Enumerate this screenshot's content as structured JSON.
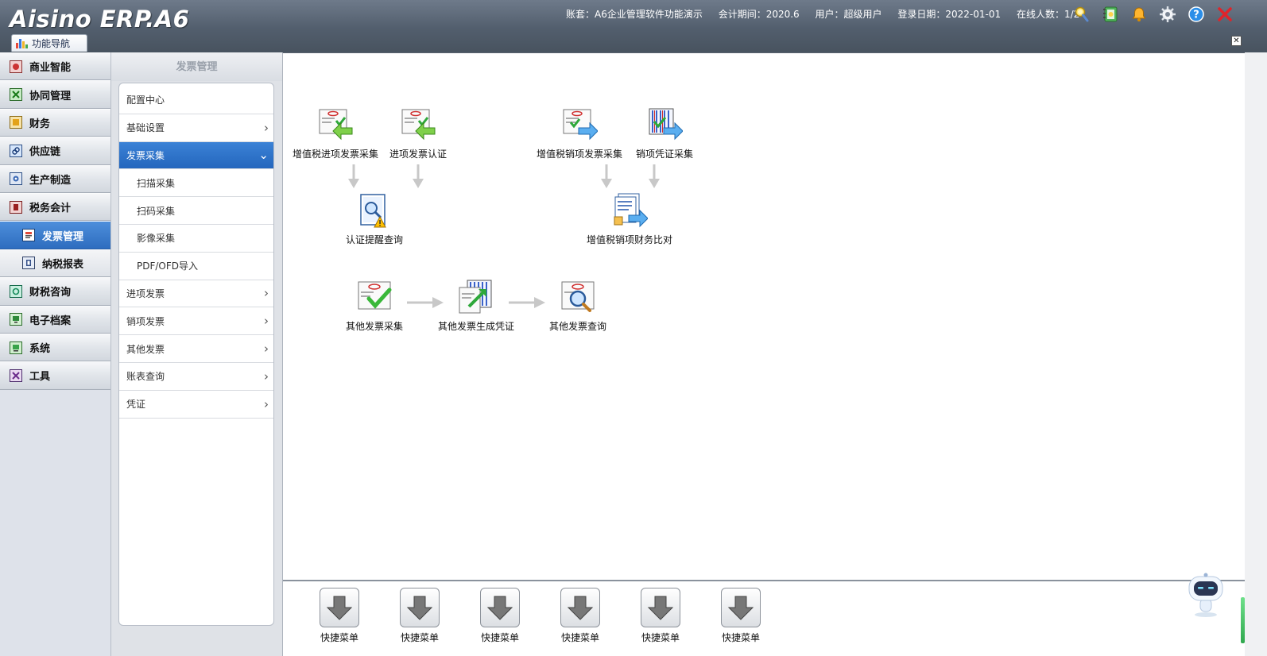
{
  "header": {
    "logo": "Aisino ERP.A6",
    "account": "账套：A6企业管理软件功能演示",
    "period": "会计期间：2020.6",
    "user": "用户：超级用户",
    "login_date": "登录日期：2022-01-01",
    "online": "在线人数：1/2",
    "nav_tab": "功能导航",
    "close_glyph": "✕",
    "icons": [
      "search-icon",
      "notebook-icon",
      "bell-icon",
      "gear-icon",
      "help-icon",
      "close-icon"
    ]
  },
  "leftnav": {
    "items": [
      {
        "label": "商业智能"
      },
      {
        "label": "协同管理"
      },
      {
        "label": "财务"
      },
      {
        "label": "供应链"
      },
      {
        "label": "生产制造"
      },
      {
        "label": "税务会计"
      },
      {
        "label": "发票管理"
      },
      {
        "label": "纳税报表"
      },
      {
        "label": "财税咨询"
      },
      {
        "label": "电子档案"
      },
      {
        "label": "系统"
      },
      {
        "label": "工具"
      }
    ]
  },
  "panel": {
    "title": "发票管理",
    "items": [
      {
        "label": "配置中心"
      },
      {
        "label": "基础设置"
      },
      {
        "label": "发票采集"
      },
      {
        "label": "扫描采集"
      },
      {
        "label": "扫码采集"
      },
      {
        "label": "影像采集"
      },
      {
        "label": "PDF/OFD导入"
      },
      {
        "label": "进项发票"
      },
      {
        "label": "销项发票"
      },
      {
        "label": "其他发票"
      },
      {
        "label": "账表查询"
      },
      {
        "label": "凭证"
      }
    ]
  },
  "flow": {
    "nodes": [
      {
        "label": "增值税进项发票采集"
      },
      {
        "label": "进项发票认证"
      },
      {
        "label": "增值税销项发票采集"
      },
      {
        "label": "销项凭证采集"
      },
      {
        "label": "认证提醒查询"
      },
      {
        "label": "增值税销项财务比对"
      },
      {
        "label": "其他发票采集"
      },
      {
        "label": "其他发票生成凭证"
      },
      {
        "label": "其他发票查询"
      }
    ]
  },
  "quickbar": {
    "items": [
      {
        "label": "快捷菜单"
      },
      {
        "label": "快捷菜单"
      },
      {
        "label": "快捷菜单"
      },
      {
        "label": "快捷菜单"
      },
      {
        "label": "快捷菜单"
      },
      {
        "label": "快捷菜单"
      }
    ]
  },
  "colors": {
    "header_bg": "#525e6d",
    "active_blue": "#2e6dbf",
    "nav_bg": "#dee2ea"
  }
}
